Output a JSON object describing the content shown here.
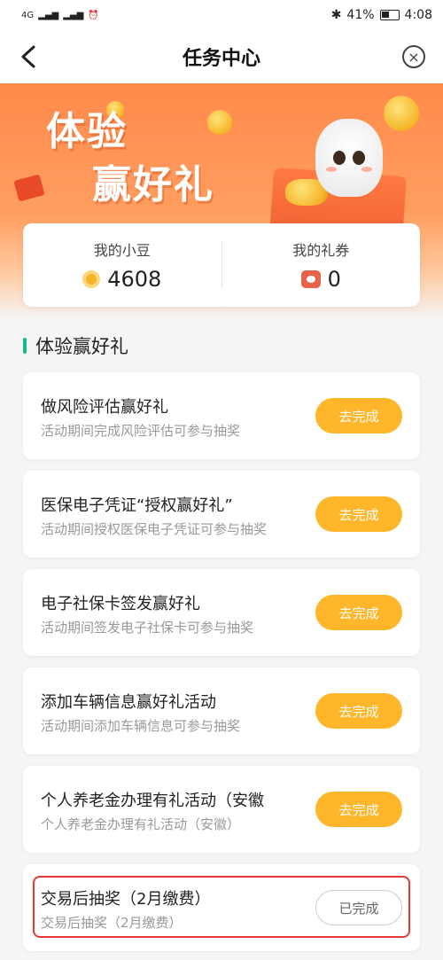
{
  "status_bar": {
    "signal": "4G",
    "battery": "41%",
    "time": "4:08"
  },
  "nav": {
    "title": "任务中心"
  },
  "banner": {
    "line1": "体验",
    "line2": "赢好礼"
  },
  "stats": {
    "beans_label": "我的小豆",
    "beans_value": "4608",
    "coupons_label": "我的礼券",
    "coupons_value": "0"
  },
  "section": {
    "title": "体验赢好礼"
  },
  "tasks": [
    {
      "title": "做风险评估赢好礼",
      "desc": "活动期间完成风险评估可参与抽奖",
      "button": "去完成"
    },
    {
      "title": "医保电子凭证“授权赢好礼”",
      "desc": "活动期间授权医保电子凭证可参与抽奖",
      "button": "去完成"
    },
    {
      "title": "电子社保卡签发赢好礼",
      "desc": "活动期间签发电子社保卡可参与抽奖",
      "button": "去完成"
    },
    {
      "title": "添加车辆信息赢好礼活动",
      "desc": "活动期间添加车辆信息可参与抽奖",
      "button": "去完成"
    },
    {
      "title": "个人养老金办理有礼活动（安徽",
      "desc": "个人养老金办理有礼活动（安徽）",
      "button": "去完成"
    },
    {
      "title": "交易后抽奖（2月缴费）",
      "desc": "交易后抽奖（2月缴费）",
      "button": "已完成"
    }
  ],
  "colors": {
    "accent": "#ffb62a",
    "section_bar": "#19b98e",
    "highlight": "#e53935"
  }
}
